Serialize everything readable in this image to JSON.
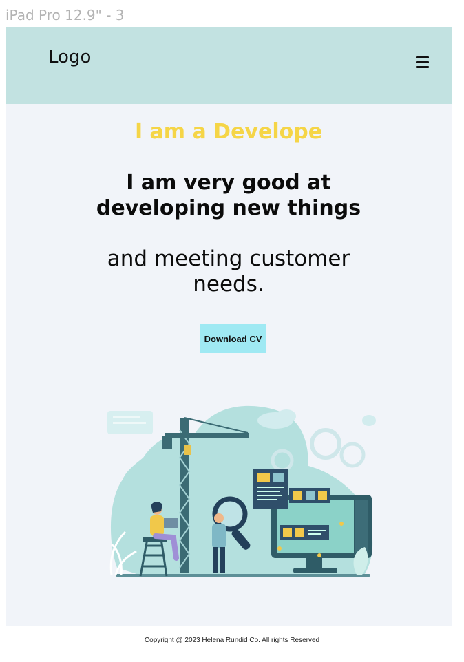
{
  "frame_label": "iPad Pro 12.9\" - 3",
  "header": {
    "logo": "Logo",
    "menu_icon": "hamburger-menu-icon"
  },
  "hero": {
    "subtitle": "I am a Develope",
    "title": "I am very good at developing new things",
    "text": "and meeting customer needs.",
    "cta_label": "Download CV",
    "illustration_icon": "developer-construction-illustration"
  },
  "footer": {
    "copyright": "Copyright @ 2023 Helena Rundid Co. All rights Reserved"
  },
  "colors": {
    "header_bg": "#c2e2e1",
    "page_bg": "#f1f4f9",
    "accent_yellow": "#f5d547",
    "button_bg": "#9fe9f3"
  }
}
